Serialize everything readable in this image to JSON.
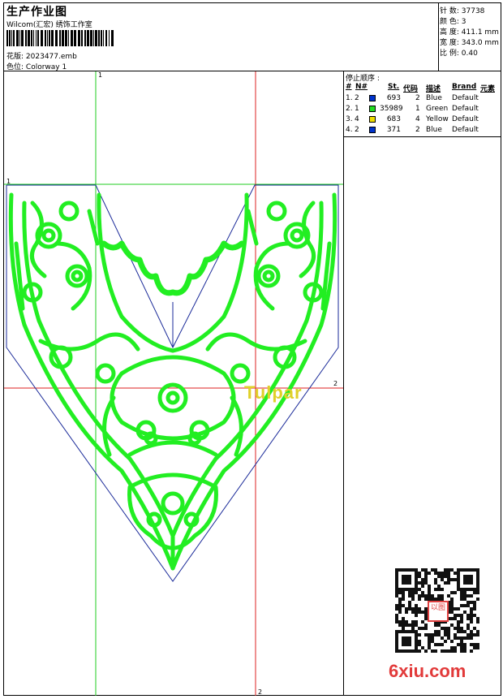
{
  "header": {
    "title": "生产作业图",
    "company": "Wilcom(汇宏) 绣饰工作室",
    "design_label": "花版:",
    "design_file": "2023477.emb",
    "colorway_label": "色位:",
    "colorway": "Colorway 1"
  },
  "stats": [
    {
      "label": "针 数:",
      "value": "37738"
    },
    {
      "label": "颜 色:",
      "value": "3"
    },
    {
      "label": "高 度:",
      "value": "411.1 mm"
    },
    {
      "label": "宽 度:",
      "value": "343.0 mm"
    },
    {
      "label": "比 例:",
      "value": "0.40"
    }
  ],
  "stop_sequence": {
    "title": "停止顺序 :",
    "columns": [
      "#",
      "N#",
      "St.",
      "代码",
      "描述",
      "Brand",
      "元素"
    ],
    "rows": [
      {
        "index": "1.",
        "n": "2",
        "stitches": "693",
        "code": "2",
        "desc": "Blue",
        "brand": "Default",
        "color": "#0033cc"
      },
      {
        "index": "2.",
        "n": "1",
        "stitches": "35989",
        "code": "1",
        "desc": "Green",
        "brand": "Default",
        "color": "#22dd22"
      },
      {
        "index": "3.",
        "n": "4",
        "stitches": "683",
        "code": "4",
        "desc": "Yellow",
        "brand": "Default",
        "color": "#eedd00"
      },
      {
        "index": "4.",
        "n": "2",
        "stitches": "371",
        "code": "2",
        "desc": "Blue",
        "brand": "Default",
        "color": "#0033cc"
      }
    ]
  },
  "canvas": {
    "guide_labels": {
      "green_top": "1",
      "green_left": "1",
      "red_right": "2",
      "red_bottom": "2"
    },
    "lettering": "Tulpar",
    "accent_green": "#22ee22",
    "accent_blue": "#1a2a99",
    "guide_red": "#dd2222"
  },
  "watermark": {
    "qr_label": "以图",
    "site": "6xiu.com"
  }
}
